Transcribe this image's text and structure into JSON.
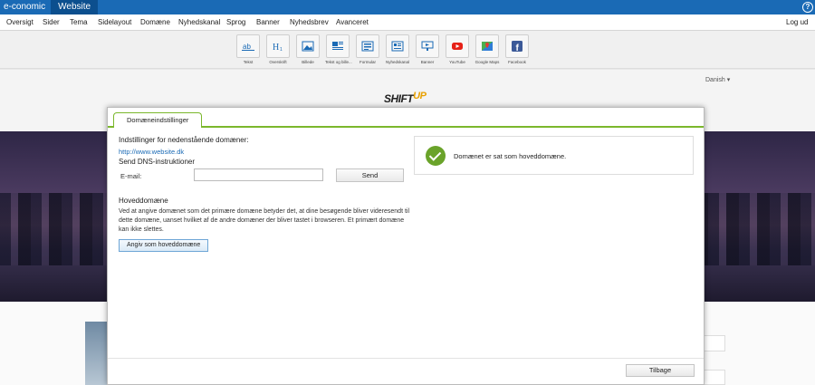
{
  "topbar": {
    "brand": "e-conomic",
    "site_tab": "Website",
    "help": "?"
  },
  "menu": {
    "items": [
      "Oversigt",
      "Sider",
      "Tema",
      "Sidelayout",
      "Domæne",
      "Nyhedskanal",
      "Sprog",
      "Banner",
      "Nyhedsbrev",
      "Avanceret"
    ],
    "logout": "Log ud"
  },
  "toolbar": {
    "tools": [
      {
        "label": "Tekst",
        "icon": "text-icon"
      },
      {
        "label": "Overskrift",
        "icon": "heading-icon"
      },
      {
        "label": "Billede",
        "icon": "image-icon"
      },
      {
        "label": "Tekst og bille...",
        "icon": "text-image-icon"
      },
      {
        "label": "Formular",
        "icon": "form-icon"
      },
      {
        "label": "Nyhedskanal",
        "icon": "news-icon"
      },
      {
        "label": "Banner",
        "icon": "banner-icon"
      },
      {
        "label": "YouTube",
        "icon": "youtube-icon"
      },
      {
        "label": "Google Maps",
        "icon": "maps-icon"
      },
      {
        "label": "Facebook",
        "icon": "facebook-icon"
      }
    ]
  },
  "page": {
    "language": "Danish ▾",
    "logo_main": "SHIFT",
    "logo_up": "UP"
  },
  "modal": {
    "tab": "Domæneindstillinger",
    "settings_heading": "Indstillinger for nedenstående domæner:",
    "domain_link": "http://www.website.dk",
    "dns_heading": "Send DNS-instruktioner",
    "email_label": "E-mail:",
    "email_value": "",
    "send_label": "Send",
    "primary_heading": "Hoveddomæne",
    "primary_desc": "Ved at angive domænet som det primære domæne betyder det, at dine besøgende bliver videresendt til dette domæne, uanset hvilket af de andre domæner der bliver tastet i browseren. Et primært domæne kan ikke slettes.",
    "primary_button": "Angiv som hoveddomæne",
    "notice_text": "Domænet er sat som hoveddomæne.",
    "back_button": "Tilbage"
  },
  "colors": {
    "topbar": "#1a6ab5",
    "accent_green": "#7bb72c",
    "success": "#6aa32a",
    "link": "#1a6ab5"
  }
}
